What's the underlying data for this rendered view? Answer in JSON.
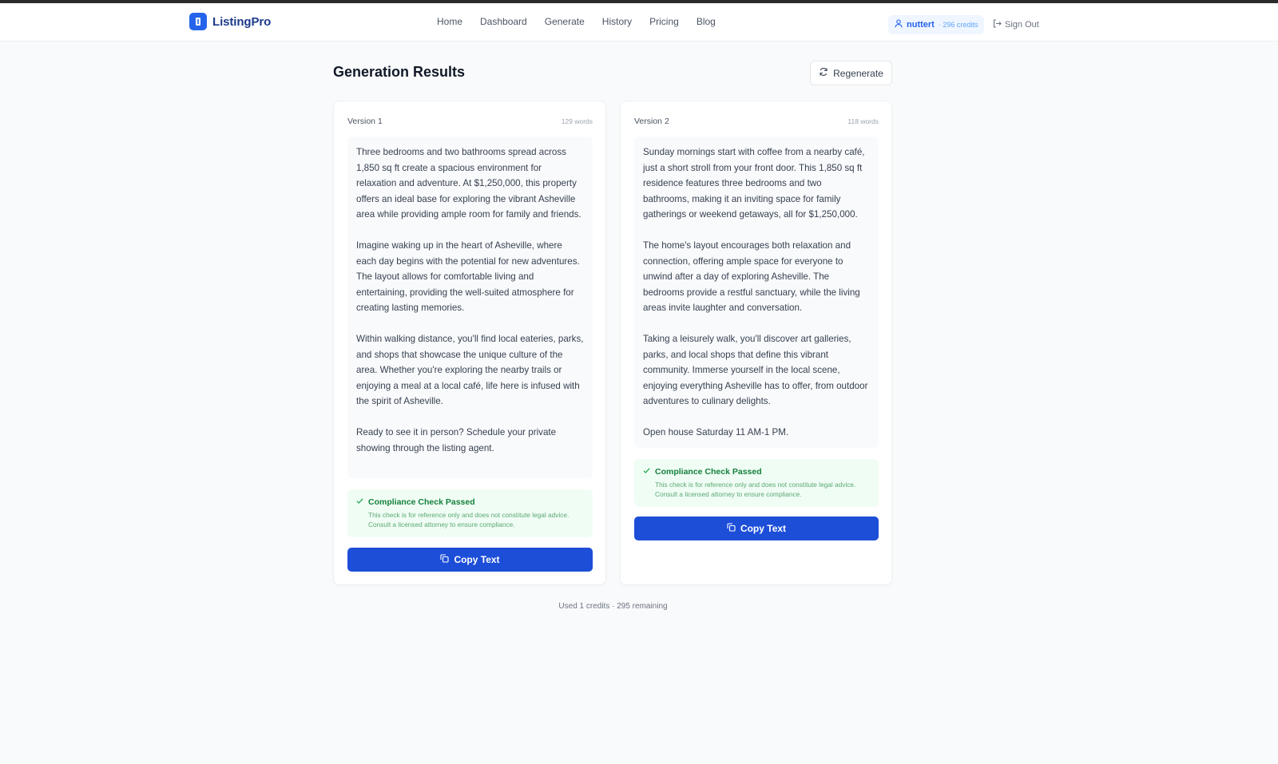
{
  "brand": {
    "name": "ListingPro",
    "accent": "#2563eb"
  },
  "nav": {
    "links": [
      "Home",
      "Dashboard",
      "Generate",
      "History",
      "Pricing",
      "Blog"
    ]
  },
  "user": {
    "name": "nuttert",
    "credits": "· 296 credits",
    "signout": "Sign Out"
  },
  "page": {
    "title": "Generation Results",
    "regenerate": "Regenerate"
  },
  "versions": [
    {
      "label": "Version 1",
      "words": "129 words",
      "paragraphs": [
        "Three bedrooms and two bathrooms spread across 1,850 sq ft create a spacious environment for relaxation and adventure. At $1,250,000, this property offers an ideal base for exploring the vibrant Asheville area while providing ample room for family and friends.",
        "Imagine waking up in the heart of Asheville, where each day begins with the potential for new adventures. The layout allows for comfortable living and entertaining, providing the well-suited atmosphere for creating lasting memories.",
        "Within walking distance, you'll find local eateries, parks, and shops that showcase the unique culture of the area. Whether you're exploring the nearby trails or enjoying a meal at a local café, life here is infused with the spirit of Asheville.",
        "Ready to see it in person? Schedule your private showing through the listing agent."
      ],
      "compliance_title": "Compliance Check Passed",
      "compliance_note": "This check is for reference only and does not constitute legal advice. Consult a licensed attorney to ensure compliance.",
      "copy_label": "Copy Text"
    },
    {
      "label": "Version 2",
      "words": "118 words",
      "paragraphs": [
        "Sunday mornings start with coffee from a nearby café, just a short stroll from your front door. This 1,850 sq ft residence features three bedrooms and two bathrooms, making it an inviting space for family gatherings or weekend getaways, all for $1,250,000.",
        "The home's layout encourages both relaxation and connection, offering ample space for everyone to unwind after a day of exploring Asheville. The bedrooms provide a restful sanctuary, while the living areas invite laughter and conversation.",
        "Taking a leisurely walk, you'll discover art galleries, parks, and local shops that define this vibrant community. Immerse yourself in the local scene, enjoying everything Asheville has to offer, from outdoor adventures to culinary delights.",
        "Open house Saturday 11 AM-1 PM."
      ],
      "compliance_title": "Compliance Check Passed",
      "compliance_note": "This check is for reference only and does not constitute legal advice. Consult a licensed attorney to ensure compliance.",
      "copy_label": "Copy Text"
    }
  ],
  "footer": {
    "usage": "Used 1 credits · 295 remaining"
  }
}
